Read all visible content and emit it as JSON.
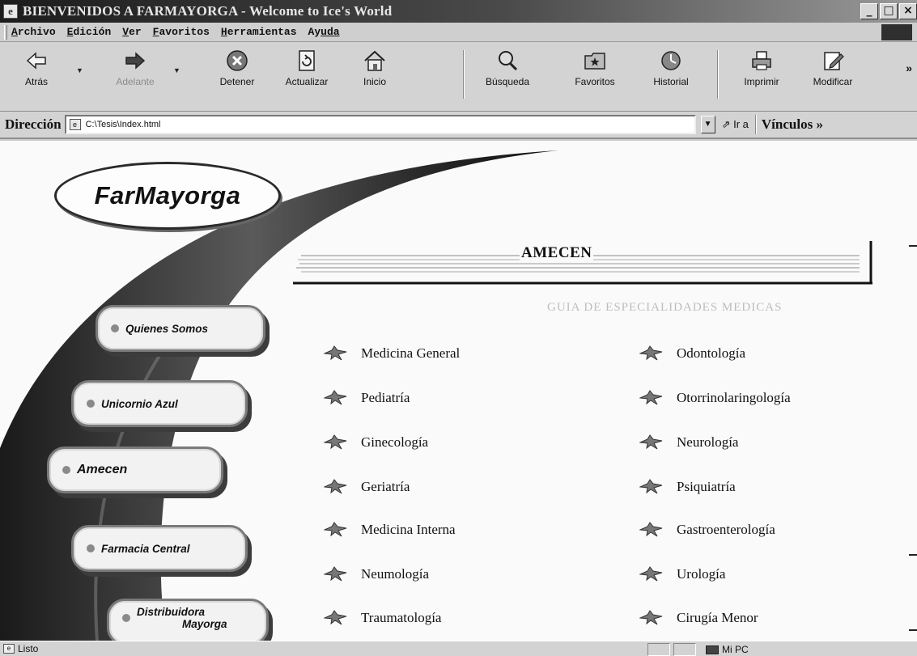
{
  "window": {
    "title": "BIENVENIDOS A FARMAYORGA - Welcome to Ice's World",
    "controls": [
      "_",
      "□",
      "×"
    ]
  },
  "menu": {
    "items": [
      {
        "key": "A",
        "rest": "rchivo"
      },
      {
        "key": "E",
        "rest": "dición"
      },
      {
        "key": "V",
        "rest": "er"
      },
      {
        "key": "F",
        "rest": "avoritos"
      },
      {
        "key": "H",
        "rest": "erramientas"
      },
      {
        "key": "Ay",
        "rest": "uda"
      }
    ]
  },
  "toolbar": {
    "back": "Atrás",
    "forward": "Adelante",
    "stop": "Detener",
    "refresh": "Actualizar",
    "home": "Inicio",
    "search": "Búsqueda",
    "favorites": "Favoritos",
    "history": "Historial",
    "print": "Imprimir",
    "edit": "Modificar"
  },
  "address": {
    "label": "Dirección",
    "value": "C:\\Tesis\\Index.html",
    "go": "Ir a",
    "links": "Vínculos"
  },
  "page": {
    "logo": "FarMayorga",
    "nav": [
      "Quienes Somos",
      "Unicornio Azul",
      "Amecen",
      "Farmacia Central",
      "Distribuidora",
      "Mayorga"
    ],
    "banner_title": "AMECEN",
    "subtitle": "GUIA DE ESPECIALIDADES MEDICAS",
    "specialties_left": [
      "Medicina General",
      "Pediatría",
      "Ginecología",
      "Geriatría",
      "Medicina Interna",
      "Neumología",
      "Traumatología"
    ],
    "specialties_right": [
      "Odontología",
      "Otorrinolaringología",
      "Neurología",
      "Psiquiatría",
      "Gastroenterología",
      "Urología",
      "Cirugía Menor"
    ]
  },
  "status": {
    "text": "Listo",
    "zone": "Mi PC"
  }
}
